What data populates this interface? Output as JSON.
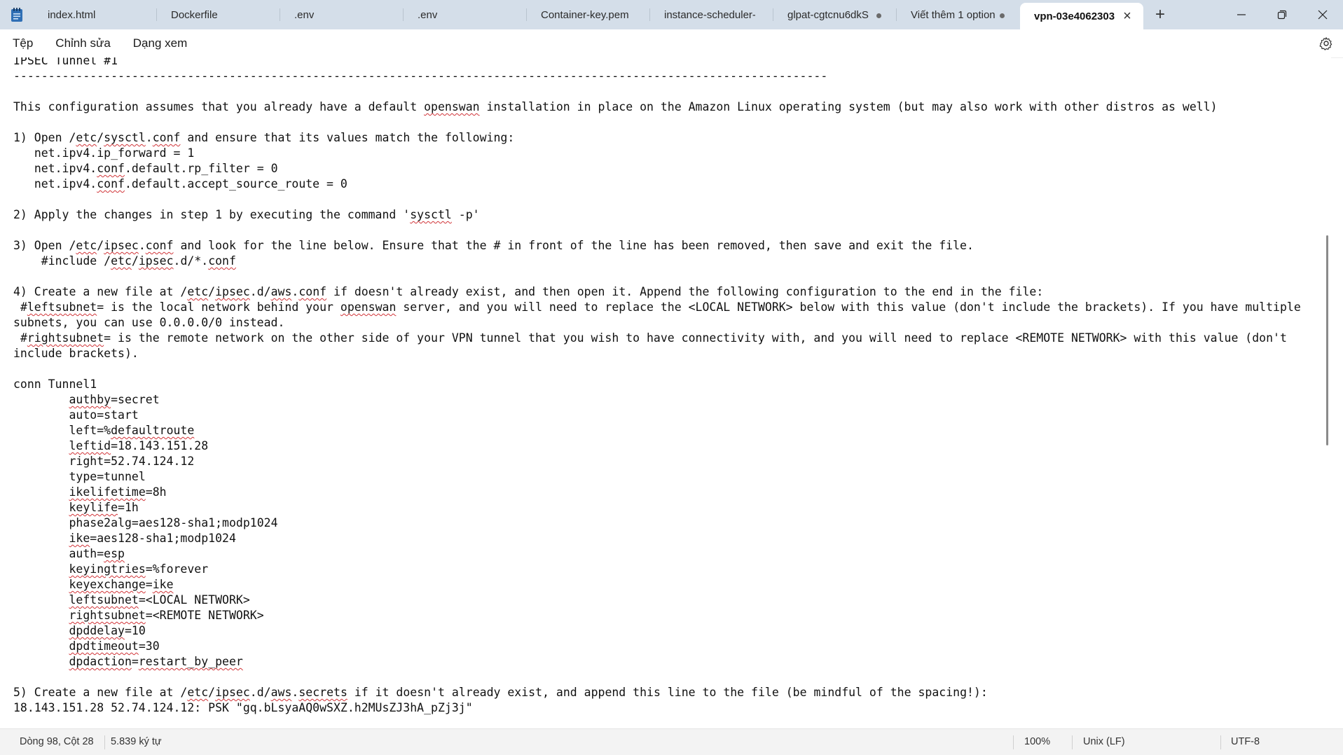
{
  "window": {
    "app_icon": "notepad-icon",
    "tabs": [
      {
        "label": "index.html",
        "dirty": false,
        "active": false
      },
      {
        "label": "Dockerfile",
        "dirty": false,
        "active": false
      },
      {
        "label": ".env",
        "dirty": false,
        "active": false
      },
      {
        "label": ".env",
        "dirty": false,
        "active": false
      },
      {
        "label": "Container-key.pem",
        "dirty": false,
        "active": false
      },
      {
        "label": "instance-scheduler-on-a",
        "dirty": false,
        "active": false
      },
      {
        "label": "glpat-cgtcnu6dkS",
        "dirty": true,
        "active": false
      },
      {
        "label": "Viết thêm 1 option",
        "dirty": true,
        "active": false
      },
      {
        "label": "vpn-03e4062303",
        "dirty": false,
        "active": true
      }
    ],
    "new_tab_icon": "plus-icon",
    "controls": {
      "minimize": "minimize-icon",
      "maximize": "restore-icon",
      "close": "close-icon"
    }
  },
  "menu": {
    "file": "Tệp",
    "edit": "Chỉnh sửa",
    "view": "Dạng xem",
    "settings_icon": "gear-icon"
  },
  "editor": {
    "lines": [
      "IPSEC Tunnel #1",
      "---------------------------------------------------------------------------------------------------------------------",
      "",
      "This configuration assumes that you already have a default openswan installation in place on the Amazon Linux operating system (but may also work with other distros as well)",
      "",
      "1) Open /etc/sysctl.conf and ensure that its values match the following:",
      "   net.ipv4.ip_forward = 1",
      "   net.ipv4.conf.default.rp_filter = 0",
      "   net.ipv4.conf.default.accept_source_route = 0",
      "",
      "2) Apply the changes in step 1 by executing the command 'sysctl -p'",
      "",
      "3) Open /etc/ipsec.conf and look for the line below. Ensure that the # in front of the line has been removed, then save and exit the file.",
      "    #include /etc/ipsec.d/*.conf",
      "",
      "4) Create a new file at /etc/ipsec.d/aws.conf if doesn't already exist, and then open it. Append the following configuration to the end in the file:",
      " #leftsubnet= is the local network behind your openswan server, and you will need to replace the <LOCAL NETWORK> below with this value (don't include the brackets). If you have multiple subnets, you can use 0.0.0.0/0 instead.",
      " #rightsubnet= is the remote network on the other side of your VPN tunnel that you wish to have connectivity with, and you will need to replace <REMOTE NETWORK> with this value (don't include brackets).",
      "",
      "conn Tunnel1",
      "        authby=secret",
      "        auto=start",
      "        left=%defaultroute",
      "        leftid=18.143.151.28",
      "        right=52.74.124.12",
      "        type=tunnel",
      "        ikelifetime=8h",
      "        keylife=1h",
      "        phase2alg=aes128-sha1;modp1024",
      "        ike=aes128-sha1;modp1024",
      "        auth=esp",
      "        keyingtries=%forever",
      "        keyexchange=ike",
      "        leftsubnet=<LOCAL NETWORK>",
      "        rightsubnet=<REMOTE NETWORK>",
      "        dpddelay=10",
      "        dpdtimeout=30",
      "        dpdaction=restart_by_peer",
      "",
      "5) Create a new file at /etc/ipsec.d/aws.secrets if it doesn't already exist, and append this line to the file (be mindful of the spacing!):",
      "18.143.151.28 52.74.124.12: PSK \"gq.bLsyaAQ0wSXZ.h2MUsZJ3hA_pZj3j\""
    ],
    "misspelled_words": [
      "openswan",
      "sysctl",
      "ipsec",
      "etc",
      "aws",
      "authby",
      "defaultroute",
      "leftid",
      "ikelifetime",
      "keylife",
      "ike",
      "esp",
      "keyingtries",
      "keyexchange",
      "leftsubnet",
      "rightsubnet",
      "dpddelay",
      "dpdtimeout",
      "dpdaction",
      "restart_by_peer",
      "secrets",
      "conf"
    ]
  },
  "status": {
    "position": "Dòng 98, Cột 28",
    "char_count": "5.839 ký tự",
    "zoom": "100%",
    "line_ending": "Unix (LF)",
    "encoding": "UTF-8"
  },
  "colors": {
    "tabbar_bg": "#d4dee9",
    "active_tab_bg": "#ffffff",
    "squiggle": "#d13438",
    "status_bg": "#f3f3f3"
  }
}
